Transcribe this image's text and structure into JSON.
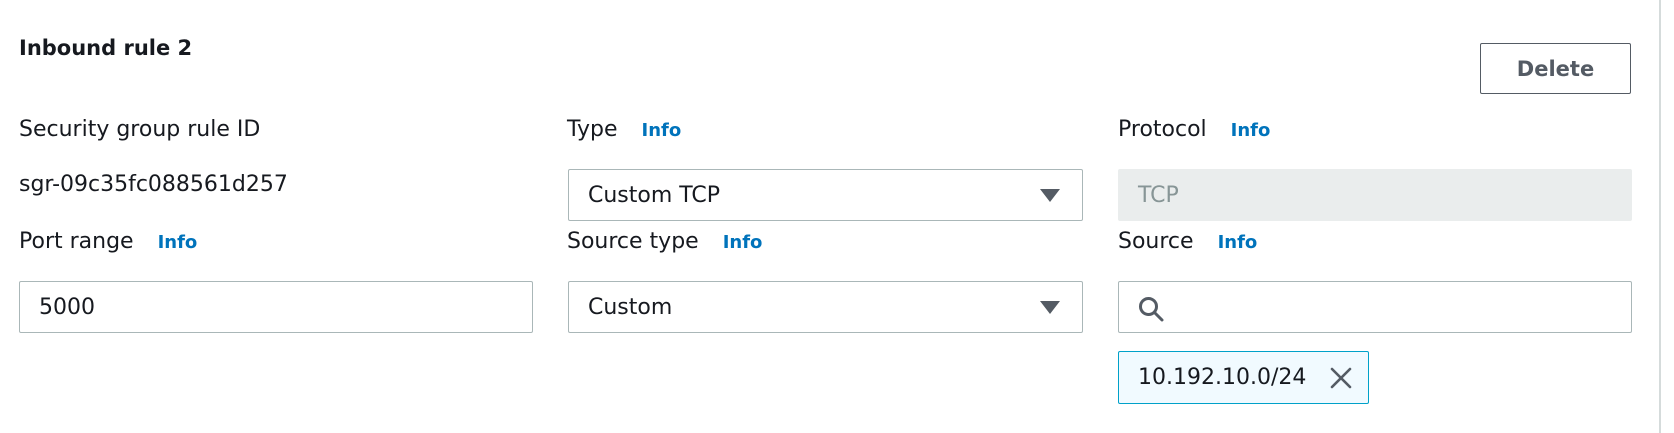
{
  "rule": {
    "title": "Inbound rule 2",
    "delete_label": "Delete"
  },
  "fields": {
    "rule_id": {
      "label": "Security group rule ID",
      "value": "sgr-09c35fc088561d257"
    },
    "type": {
      "label": "Type",
      "info": "Info",
      "value": "Custom TCP"
    },
    "protocol": {
      "label": "Protocol",
      "info": "Info",
      "value": "TCP"
    },
    "port_range": {
      "label": "Port range",
      "info": "Info",
      "value": "5000"
    },
    "source_type": {
      "label": "Source type",
      "info": "Info",
      "value": "Custom"
    },
    "source": {
      "label": "Source",
      "info": "Info",
      "value": "",
      "token": "10.192.10.0/24"
    }
  },
  "icons": {
    "dropdown": "caret-down-icon",
    "search": "search-icon",
    "remove": "close-icon"
  },
  "colors": {
    "link": "#0073bb",
    "token_border": "#00a1c9",
    "token_bg": "#f1faff",
    "disabled_bg": "#eaeded"
  }
}
